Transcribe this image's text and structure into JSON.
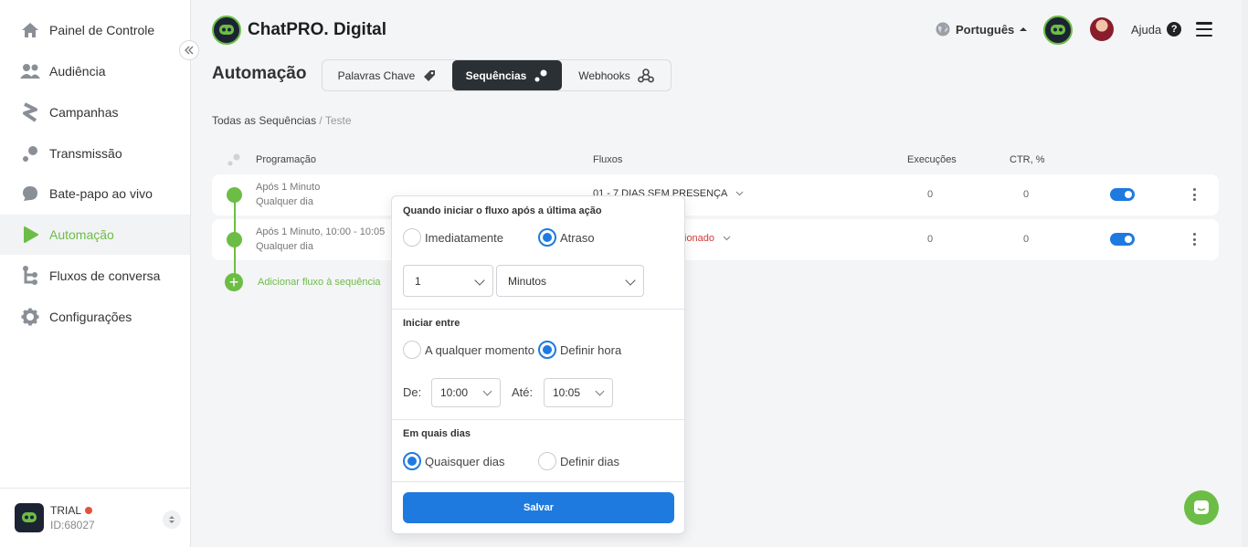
{
  "brand": {
    "name": "ChatPRO. Digital"
  },
  "header": {
    "language": "Português",
    "help_label": "Ajuda",
    "help_glyph": "?"
  },
  "sidebar": {
    "items": [
      {
        "label": "Painel de Controle",
        "icon": "home-icon"
      },
      {
        "label": "Audiência",
        "icon": "users-icon"
      },
      {
        "label": "Campanhas",
        "icon": "campaign-icon"
      },
      {
        "label": "Transmissão",
        "icon": "broadcast-icon"
      },
      {
        "label": "Bate-papo ao vivo",
        "icon": "chat-bubble-icon"
      },
      {
        "label": "Automação",
        "icon": "play-icon",
        "active": true
      },
      {
        "label": "Fluxos de conversa",
        "icon": "flow-icon"
      },
      {
        "label": "Configurações",
        "icon": "gear-icon"
      }
    ],
    "footer": {
      "plan": "TRIAL",
      "account_id": "ID:68027"
    }
  },
  "page": {
    "title": "Automação",
    "tabs": [
      {
        "label": "Palavras Chave",
        "icon": "tag-icon"
      },
      {
        "label": "Sequências",
        "icon": "sequence-icon",
        "active": true
      },
      {
        "label": "Webhooks",
        "icon": "webhook-icon"
      }
    ],
    "breadcrumb": {
      "root": "Todas as Sequências",
      "separator": " / ",
      "current": "Teste"
    }
  },
  "table": {
    "headers": {
      "schedule": "Programação",
      "flows": "Fluxos",
      "executions": "Execuções",
      "ctr": "CTR, %"
    },
    "rows": [
      {
        "schedule_line1": "Após 1 Minuto",
        "schedule_line2": "Qualquer dia",
        "flow": "01 - 7 DIAS SEM PRESENÇA",
        "executions": "0",
        "ctr": "0",
        "enabled": true
      },
      {
        "schedule_line1": "Após 1 Minuto, 10:00 - 10:05",
        "schedule_line2": "Qualquer dia",
        "flow": "ionado",
        "executions": "0",
        "ctr": "0",
        "enabled": true
      }
    ],
    "add_label": "Adicionar fluxo à sequência"
  },
  "popover": {
    "start_title": "Quando iniciar o fluxo após a última ação",
    "start_options": {
      "immediate": "Imediatamente",
      "delay": "Atraso",
      "selected": "delay"
    },
    "delay_value": "1",
    "delay_unit": "Minutos",
    "between_title": "Iniciar entre",
    "between_options": {
      "any": "A qualquer momento",
      "set": "Definir hora",
      "selected": "set"
    },
    "from_label": "De:",
    "from_value": "10:00",
    "to_label": "Até:",
    "to_value": "10:05",
    "days_title": "Em quais dias",
    "days_options": {
      "any": "Quaisquer dias",
      "set": "Definir dias",
      "selected": "any"
    },
    "save_label": "Salvar"
  },
  "colors": {
    "accent_green": "#6cbd45",
    "primary_blue": "#1f7ae0",
    "dark": "#2b3035",
    "warning_red": "#d23b3b"
  }
}
